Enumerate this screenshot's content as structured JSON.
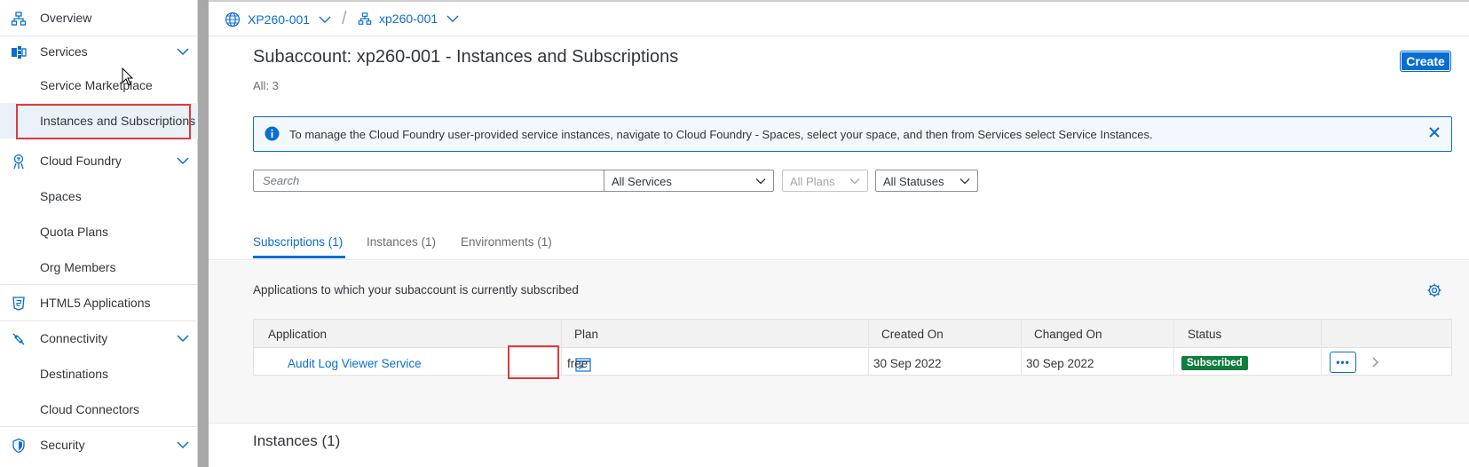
{
  "colors": {
    "accent": "#0a6ed1",
    "status_subscribed": "#107e3e",
    "highlight": "#e0393e"
  },
  "sidebar": {
    "items": [
      {
        "label": "Overview",
        "icon": "hierarchy-icon"
      },
      {
        "label": "Services",
        "icon": "services-icon",
        "expandable": true
      },
      {
        "label": "Service Marketplace"
      },
      {
        "label": "Instances and Subscriptions",
        "selected": true
      },
      {
        "label": "Cloud Foundry",
        "icon": "cloud-foundry-icon",
        "expandable": true
      },
      {
        "label": "Spaces"
      },
      {
        "label": "Quota Plans"
      },
      {
        "label": "Org Members"
      },
      {
        "label": "HTML5 Applications",
        "icon": "html5-icon"
      },
      {
        "label": "Connectivity",
        "icon": "connectivity-icon",
        "expandable": true
      },
      {
        "label": "Destinations"
      },
      {
        "label": "Cloud Connectors"
      },
      {
        "label": "Security",
        "icon": "shield-icon",
        "expandable": true
      }
    ]
  },
  "breadcrumb": {
    "global_account": "XP260-001",
    "subaccount": "xp260-001",
    "separator": "/"
  },
  "page": {
    "title": "Subaccount: xp260-001 - Instances and Subscriptions",
    "count": "All: 3",
    "create_label": "Create"
  },
  "info_strip": {
    "text": "To manage the Cloud Foundry user-provided service instances, navigate to Cloud Foundry - Spaces, select your space, and then from Services select Service Instances."
  },
  "filters": {
    "search_placeholder": "Search",
    "services": "All Services",
    "plans": "All Plans",
    "statuses": "All Statuses"
  },
  "tabs": [
    {
      "label": "Subscriptions (1)",
      "active": true
    },
    {
      "label": "Instances (1)"
    },
    {
      "label": "Environments (1)"
    }
  ],
  "subscriptions": {
    "subtitle": "Applications to which your subaccount is currently subscribed",
    "columns": [
      "Application",
      "Plan",
      "Created On",
      "Changed On",
      "Status"
    ],
    "rows": [
      {
        "application": "Audit Log Viewer Service",
        "plan": "free",
        "created_on": "30 Sep 2022",
        "changed_on": "30 Sep 2022",
        "status": "Subscribed"
      }
    ],
    "more_label": "•••"
  },
  "instances_section": {
    "title": "Instances (1)"
  }
}
